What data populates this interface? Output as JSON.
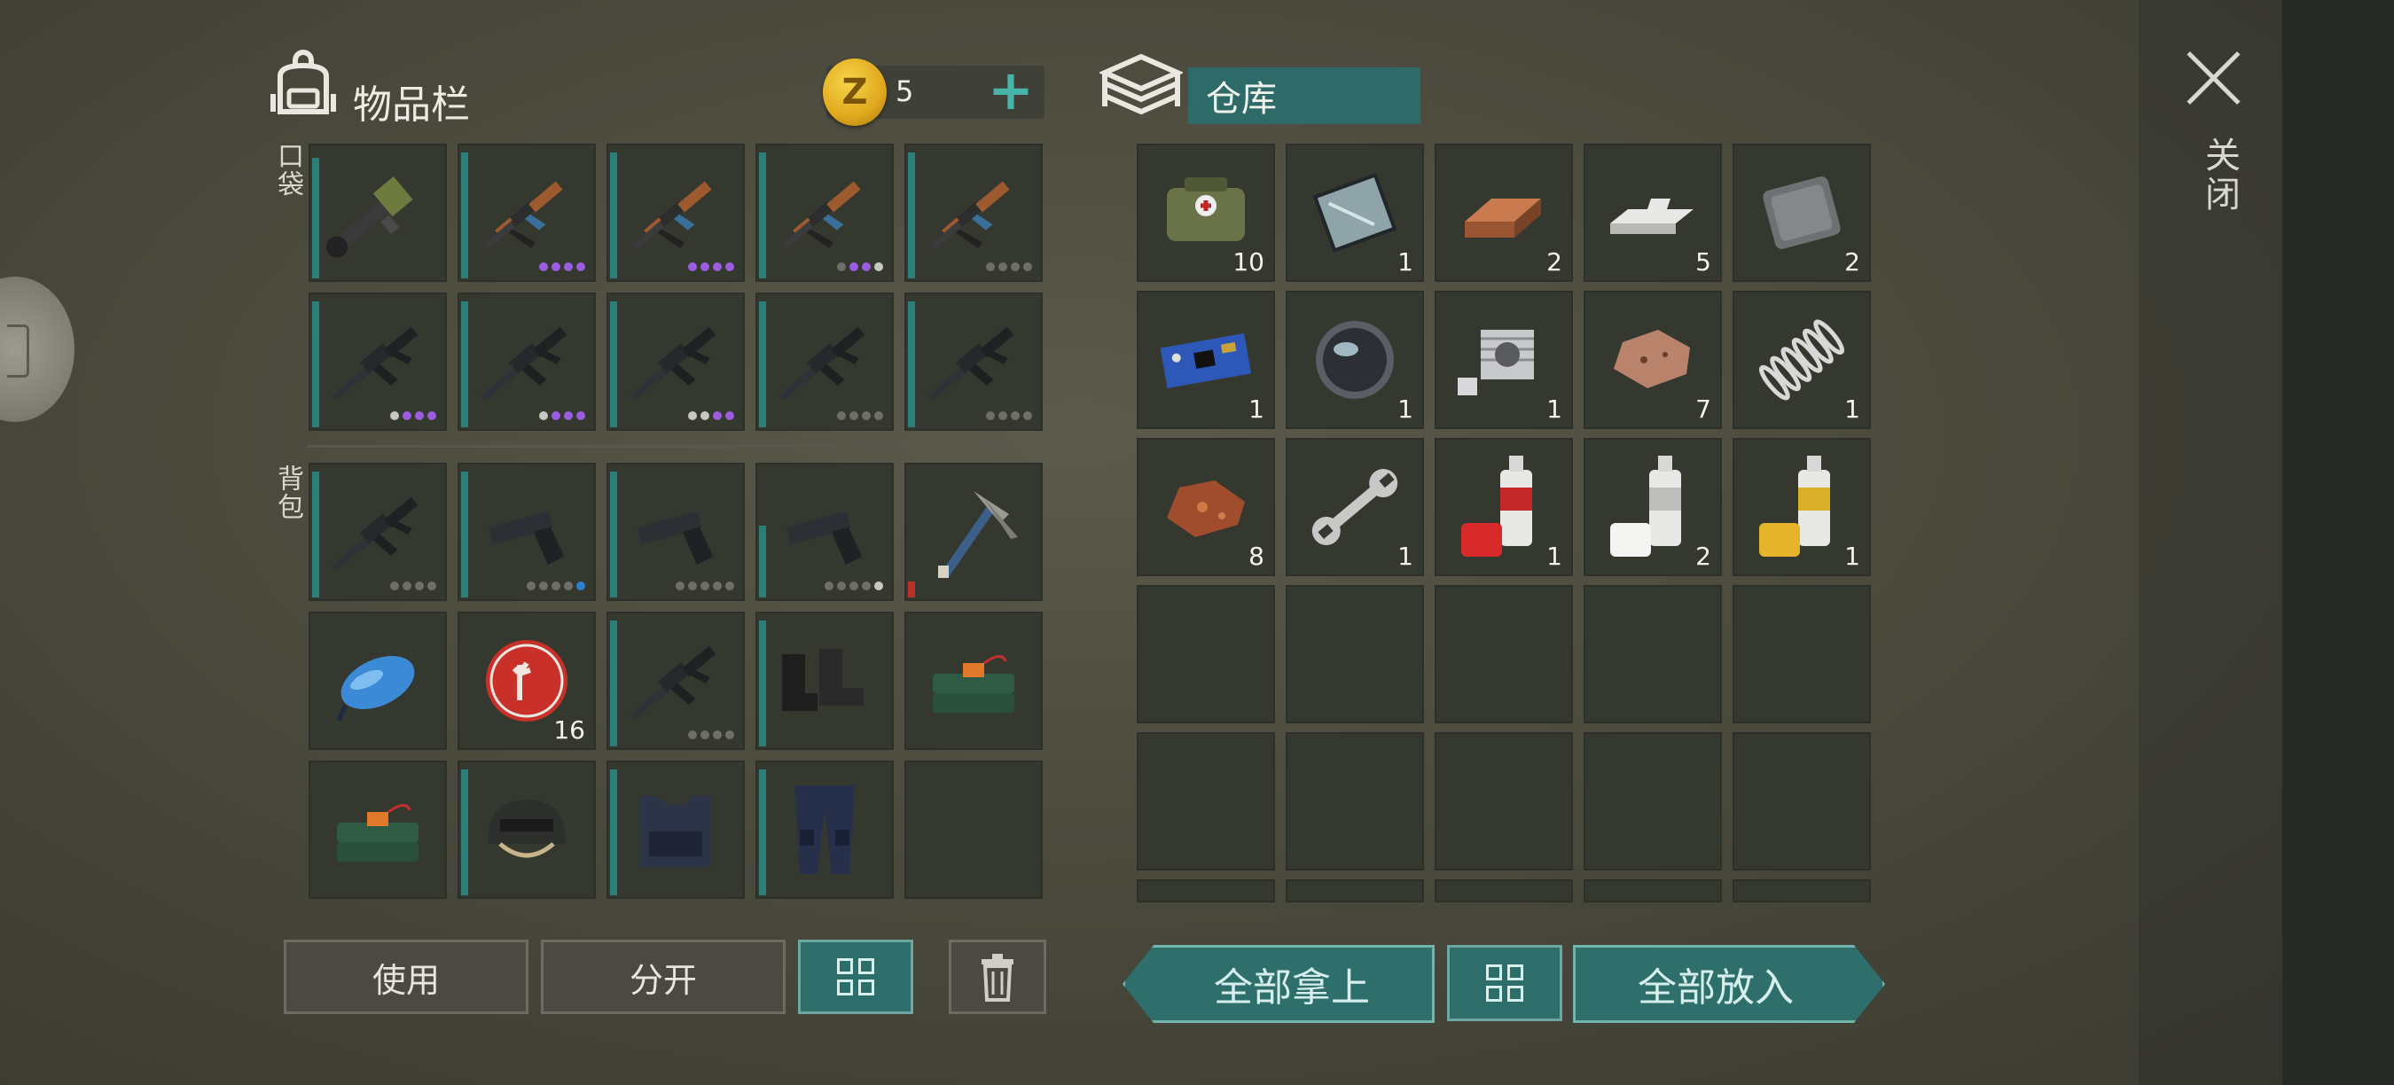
{
  "inventory": {
    "title": "物品栏",
    "coins": "5",
    "coin_symbol": "Z",
    "pockets_label": "口袋",
    "backpack_label": "背包",
    "pockets": [
      {
        "icon": "minigun-icon",
        "dur": 0.92,
        "dots": ""
      },
      {
        "icon": "ak-rifle-icon",
        "dur": 0.96,
        "dots": "pppp"
      },
      {
        "icon": "ak-rifle-icon",
        "dur": 0.96,
        "dots": "pppp"
      },
      {
        "icon": "ak-rifle-icon",
        "dur": 0.96,
        "dots": "gppw"
      },
      {
        "icon": "ak-rifle-icon",
        "dur": 0.96,
        "dots": "gggg"
      },
      {
        "icon": "m16-rifle-icon",
        "dur": 0.96,
        "dots": "wppp"
      },
      {
        "icon": "m16-rifle-icon",
        "dur": 0.96,
        "dots": "wppp"
      },
      {
        "icon": "m16-rifle-icon",
        "dur": 0.96,
        "dots": "wwpp"
      },
      {
        "icon": "m16-rifle-icon",
        "dur": 0.96,
        "dots": "gggg"
      },
      {
        "icon": "m16-rifle-icon",
        "dur": 0.96,
        "dots": "gggg"
      }
    ],
    "backpack": [
      {
        "icon": "m16-rifle-icon",
        "dur": 0.96,
        "dots": "gggg"
      },
      {
        "icon": "pistol-icon",
        "dur": 0.96,
        "dots": "ggggb"
      },
      {
        "icon": "pistol-icon",
        "dur": 0.96,
        "dots": "ggggg"
      },
      {
        "icon": "pistol-icon",
        "dur": 0.55,
        "dots": "ggggw"
      },
      {
        "icon": "pickaxe-icon",
        "dur": 0.12,
        "dur_red": true,
        "dots": ""
      },
      {
        "icon": "blue-fuel-tank-icon",
        "dur": 0,
        "dots": ""
      },
      {
        "icon": "zombie-bottle-cap-icon",
        "dur": 0,
        "qty": "16",
        "dots": ""
      },
      {
        "icon": "m16-rifle-icon",
        "dur": 0.96,
        "dots": "gggg"
      },
      {
        "icon": "combat-boots-icon",
        "dur": 0.96,
        "dots": ""
      },
      {
        "icon": "c4-explosive-icon",
        "dur": 0,
        "dots": ""
      },
      {
        "icon": "c4-explosive-icon",
        "dur": 0,
        "dots": ""
      },
      {
        "icon": "helmet-icon",
        "dur": 0.96,
        "dots": ""
      },
      {
        "icon": "tactical-vest-icon",
        "dur": 0.96,
        "dots": ""
      },
      {
        "icon": "armored-pants-icon",
        "dur": 0.96,
        "dots": ""
      },
      {
        "icon": "",
        "dur": 0,
        "dots": ""
      }
    ],
    "buttons": {
      "use": "使用",
      "split": "分开"
    }
  },
  "storage": {
    "title": "仓库",
    "items": [
      {
        "icon": "medical-bag-icon",
        "qty": "10"
      },
      {
        "icon": "glass-plate-icon",
        "qty": "1"
      },
      {
        "icon": "copper-ingot-icon",
        "qty": "2"
      },
      {
        "icon": "aluminum-ingot-icon",
        "qty": "5"
      },
      {
        "icon": "steel-plate-icon",
        "qty": "2"
      },
      {
        "icon": "circuit-board-icon",
        "qty": "1"
      },
      {
        "icon": "lens-icon",
        "qty": "1"
      },
      {
        "icon": "engine-cylinder-icon",
        "qty": "1"
      },
      {
        "icon": "ore-icon",
        "qty": "7"
      },
      {
        "icon": "spring-icon",
        "qty": "1"
      },
      {
        "icon": "copper-ore-icon",
        "qty": "8"
      },
      {
        "icon": "wrench-icon",
        "qty": "1"
      },
      {
        "icon": "red-spray-paint-icon",
        "qty": "1"
      },
      {
        "icon": "white-spray-paint-icon",
        "qty": "2"
      },
      {
        "icon": "yellow-spray-paint-icon",
        "qty": "1"
      },
      {
        "icon": "",
        "qty": ""
      },
      {
        "icon": "",
        "qty": ""
      },
      {
        "icon": "",
        "qty": ""
      },
      {
        "icon": "",
        "qty": ""
      },
      {
        "icon": "",
        "qty": ""
      },
      {
        "icon": "",
        "qty": ""
      },
      {
        "icon": "",
        "qty": ""
      },
      {
        "icon": "",
        "qty": ""
      },
      {
        "icon": "",
        "qty": ""
      },
      {
        "icon": "",
        "qty": ""
      },
      {
        "icon": "",
        "qty": ""
      },
      {
        "icon": "",
        "qty": ""
      },
      {
        "icon": "",
        "qty": ""
      },
      {
        "icon": "",
        "qty": ""
      },
      {
        "icon": "",
        "qty": ""
      }
    ],
    "buttons": {
      "take_all": "全部拿上",
      "put_all": "全部放入"
    }
  },
  "close_label": "关闭",
  "colors": {
    "accent": "#2e6f6b",
    "coin": "#e0a81d",
    "rarity_purple": "#9a5de0"
  }
}
